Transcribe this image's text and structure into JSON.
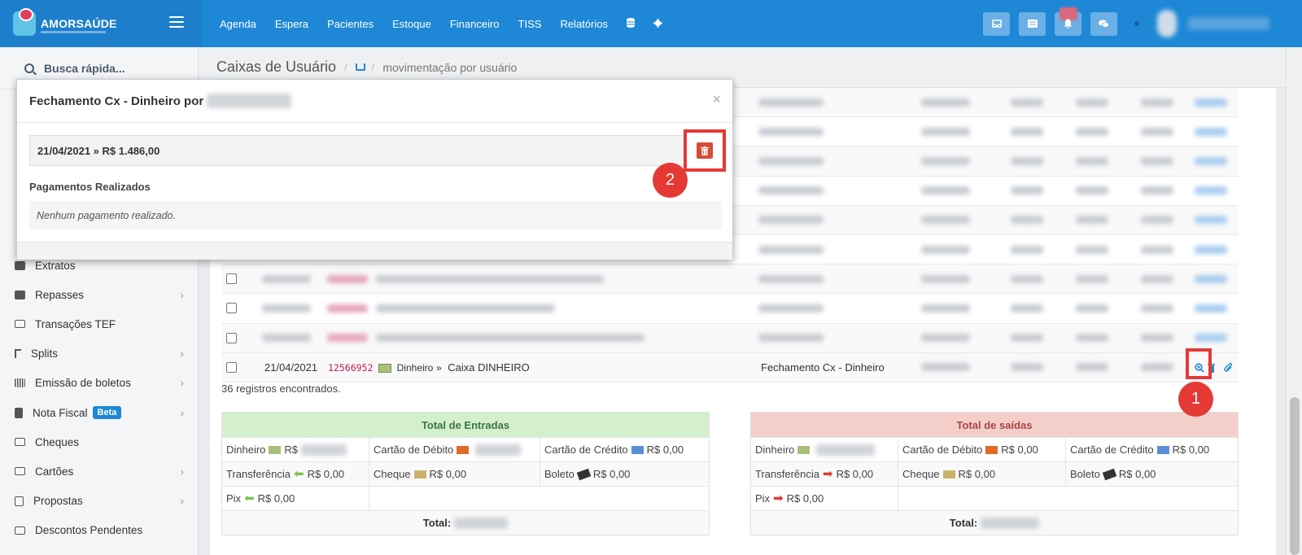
{
  "brand": {
    "name": "AMORSAÚDE"
  },
  "nav": [
    "Agenda",
    "Espera",
    "Pacientes",
    "Estoque",
    "Financeiro",
    "TISS",
    "Relatórios"
  ],
  "sidebar": {
    "search_label": "Busca rápida...",
    "items": [
      {
        "label": "Extratos"
      },
      {
        "label": "Repasses",
        "chevron": true
      },
      {
        "label": "Transações TEF"
      },
      {
        "label": "Splits",
        "chevron": true
      },
      {
        "label": "Emissão de boletos",
        "chevron": true
      },
      {
        "label": "Nota Fiscal",
        "badge": "Beta",
        "chevron": true
      },
      {
        "label": "Cheques"
      },
      {
        "label": "Cartões",
        "chevron": true
      },
      {
        "label": "Propostas",
        "chevron": true
      },
      {
        "label": "Descontos Pendentes"
      }
    ]
  },
  "header": {
    "title": "Caixas de Usuário",
    "crumb": "movimentação por usuário"
  },
  "table": {
    "last_row": {
      "date": "21/04/2021",
      "code": "12566952",
      "method": "Dinheiro",
      "sep": "»",
      "desc": "Caixa DINHEIRO",
      "type": "Fechamento Cx - Dinheiro"
    },
    "count_text": "36 registros encontrados."
  },
  "entradas": {
    "title": "Total de Entradas",
    "dinheiro": "Dinheiro",
    "dinheiro_prefix": "R$",
    "debito": "Cartão de Débito",
    "credito": "Cartão de Crédito",
    "credito_val": "R$ 0,00",
    "transferencia": "Transferência",
    "transferencia_val": "R$ 0,00",
    "cheque": "Cheque",
    "cheque_val": "R$ 0,00",
    "boleto": "Boleto",
    "boleto_val": "R$ 0,00",
    "pix": "Pix",
    "pix_val": "R$ 0,00",
    "total_label": "Total:"
  },
  "saidas": {
    "title": "Total de saídas",
    "dinheiro": "Dinheiro",
    "debito": "Cartão de Débito",
    "debito_val": "R$ 0,00",
    "credito": "Cartão de Crédito",
    "credito_val": "R$ 0,00",
    "transferencia": "Transferência",
    "transferencia_val": "R$ 0,00",
    "cheque": "Cheque",
    "cheque_val": "R$ 0,00",
    "boleto": "Boleto",
    "boleto_val": "R$ 0,00",
    "pix": "Pix",
    "pix_val": "R$ 0,00",
    "total_label": "Total:"
  },
  "modal": {
    "title": "Fechamento Cx - Dinheiro por",
    "close": "×",
    "date_line": "21/04/2021 » R$ 1.486,00",
    "payments_title": "Pagamentos Realizados",
    "empty_text": "Nenhum pagamento realizado."
  },
  "markers": {
    "one": "1",
    "two": "2"
  },
  "colors": {
    "topbar": "#1e88d6",
    "accent_red": "#e53935",
    "entradas_bg": "#d4efce",
    "saidas_bg": "#f4cfca"
  }
}
